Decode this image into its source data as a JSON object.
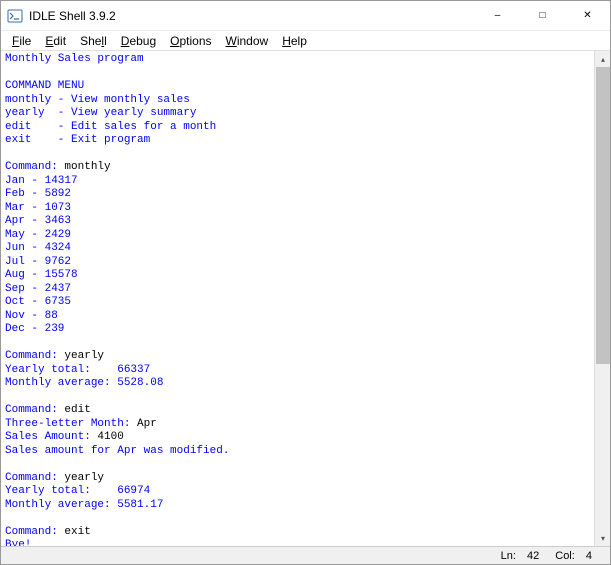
{
  "window": {
    "title": "IDLE Shell 3.9.2"
  },
  "menubar": [
    {
      "label": "File",
      "accel": "F"
    },
    {
      "label": "Edit",
      "accel": "E"
    },
    {
      "label": "Shell",
      "accel": "l"
    },
    {
      "label": "Debug",
      "accel": "D"
    },
    {
      "label": "Options",
      "accel": "O"
    },
    {
      "label": "Window",
      "accel": "W"
    },
    {
      "label": "Help",
      "accel": "H"
    }
  ],
  "status": {
    "ln_label": "Ln:",
    "ln": "42",
    "col_label": "Col:",
    "col": "4"
  },
  "shell": {
    "program_title": "Monthly Sales program",
    "menu_header": "COMMAND MENU",
    "menu_lines": [
      "monthly - View monthly sales",
      "yearly  - View yearly summary",
      "edit    - Edit sales for a month",
      "exit    - Exit program"
    ],
    "cmd_prompt": "Command: ",
    "inputs": {
      "cmd1": "monthly",
      "cmd2": "yearly",
      "cmd3": "edit",
      "edit_month_prompt": "Three-letter Month: ",
      "edit_month": "Apr",
      "edit_amount_prompt": "Sales Amount: ",
      "edit_amount": "4100",
      "cmd4": "yearly",
      "cmd5": "exit"
    },
    "monthly_rows": [
      "Jan - 14317",
      "Feb - 5892",
      "Mar - 1073",
      "Apr - 3463",
      "May - 2429",
      "Jun - 4324",
      "Jul - 9762",
      "Aug - 15578",
      "Sep - 2437",
      "Oct - 6735",
      "Nov - 88",
      "Dec - 239"
    ],
    "yearly1": {
      "total_line": "Yearly total:    66337",
      "avg_line": "Monthly average: 5528.08"
    },
    "edit_confirm": "Sales amount for Apr was modified.",
    "yearly2": {
      "total_line": "Yearly total:    66974",
      "avg_line": "Monthly average: 5581.17"
    },
    "bye": "Bye!",
    "prompt": ">>> "
  }
}
